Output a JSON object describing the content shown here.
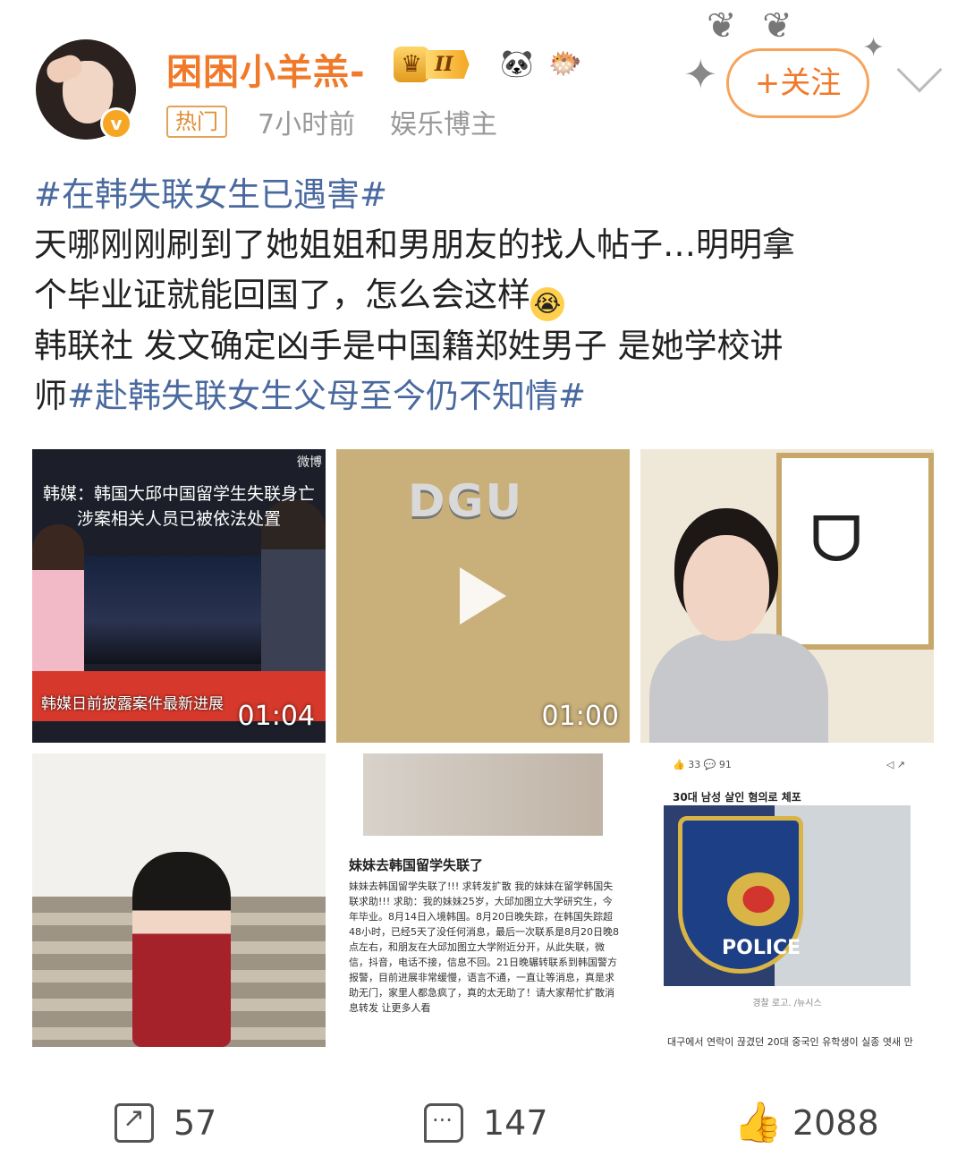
{
  "user": {
    "name": "困困小羊羔-",
    "vip_level": "II",
    "verified_badge": "v",
    "hot_tag": "热门",
    "time": "7小时前",
    "category": "娱乐博主",
    "emojis": [
      "🐼",
      "🐡"
    ]
  },
  "follow_button": "+关注",
  "post": {
    "hashtag1": "#在韩失联女生已遇害#",
    "line1": "天哪刚刚刷到了她姐姐和男朋友的找人帖子…明明拿",
    "line2": "个毕业证就能回国了，怎么会这样",
    "line2_emoji": "😭",
    "line3": "韩联社 发文确定凶手是中国籍郑姓男子 是她学校讲",
    "line4_prefix": "师",
    "hashtag2": "#赴韩失联女生父母至今仍不知情#"
  },
  "media": [
    {
      "type": "video",
      "headline": "韩媒：韩国大邱中国留学生失联身亡 涉案相关人员已被依法处置",
      "subtitle": "韩媒日前披露案件最新进展",
      "watermark": "微博",
      "duration": "01:04"
    },
    {
      "type": "video",
      "sign": "DGU",
      "duration": "01:00"
    },
    {
      "type": "image",
      "description_icon": "portrait"
    },
    {
      "type": "image",
      "description_icon": "graduation-photo"
    },
    {
      "type": "image",
      "title": "妹妹去韩国留学失联了",
      "body": "妹妹去韩国留学失联了!!! 求转发扩散 我的妹妹在留学韩国失联求助!!! 求助：我的妹妹25岁，大邱加图立大学研究生，今年毕业。8月14日入境韩国。8月20日晚失踪，在韩国失踪超48小时，已经5天了没任何消息，最后一次联系是8月20日晚8点左右，和朋友在大邱加图立大学附近分开，从此失联，微信，抖音，电话不接，信息不回。21日晚辗转联系到韩国警方报警，目前进展非常缓慢，语言不通，一直让等消息，真是求助无门，家里人都急疯了，真的太无助了！请大家帮忙扩散消息转发 让更多人看"
    },
    {
      "type": "image",
      "topbar_left": "👍 33  💬 91",
      "headline": "30대 남성 살인 혐의로 체포",
      "badge_text": "POLICE",
      "caption": "경찰 로고. /뉴시스",
      "footer": "대구에서 연락이 끊겼던 20대 중국인 유학생이 실종 엿새 만"
    }
  ],
  "actions": {
    "share": "57",
    "comment": "147",
    "like": "2088"
  },
  "colors": {
    "username": "#f07a2a",
    "hashtag": "#4a6a9f",
    "follow_border": "#f7a35b"
  }
}
